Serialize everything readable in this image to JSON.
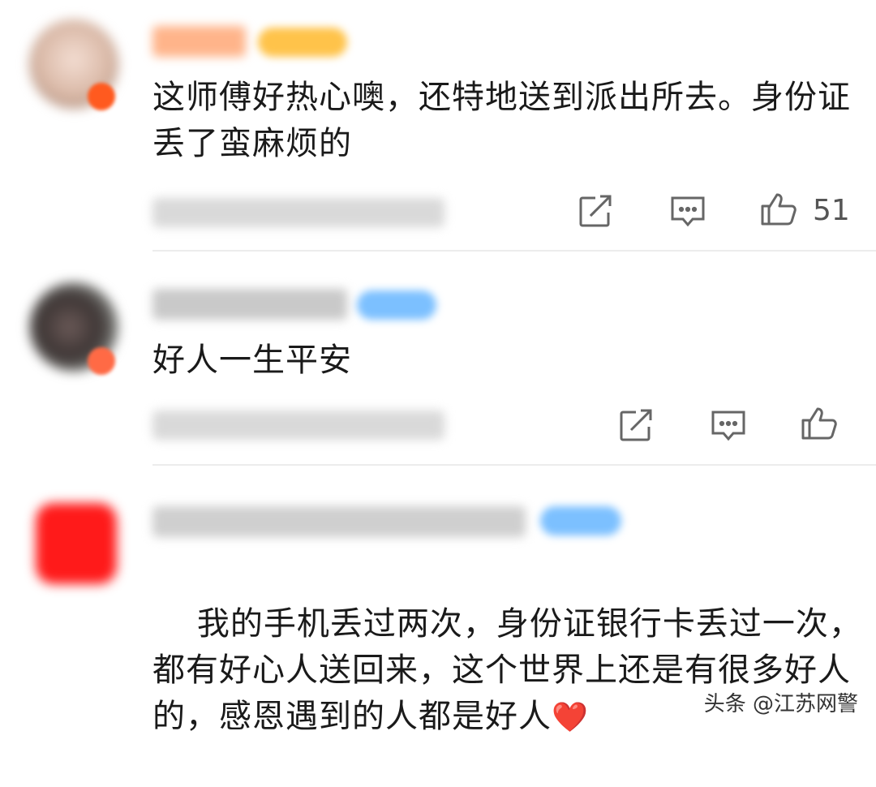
{
  "comments": [
    {
      "text": "这师傅好热心噢，还特地送到派出所去。身份证丢了蛮麻烦的",
      "like_count": "51"
    },
    {
      "text": "好人一生平安",
      "like_count": ""
    },
    {
      "text": "我的手机丢过两次，身份证银行卡丢过一次，都有好心人送回来，这个世界上还是有很多好人的，感恩遇到的人都是好人",
      "emoji": "❤️"
    }
  ],
  "icons": {
    "forward": "share-square-icon",
    "reply": "comment-bubble-icon",
    "like": "thumbs-up-icon"
  },
  "watermark": "头条 @江苏网警",
  "colors": {
    "text": "#1a1a1a",
    "divider": "#ececec",
    "vip_orange": "#ff7a1a",
    "vip_blue": "#6fb7ff"
  }
}
